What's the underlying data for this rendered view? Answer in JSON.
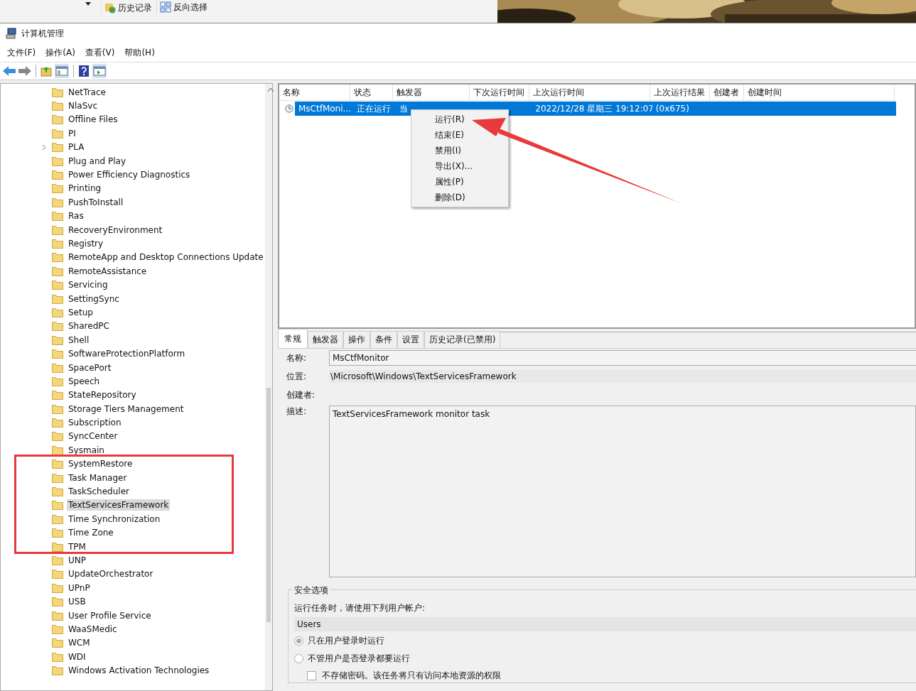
{
  "background_window": {
    "buttons": [
      {
        "label": "历史记录",
        "kind": "history"
      },
      {
        "label": "反向选择",
        "kind": "invert"
      }
    ]
  },
  "window": {
    "title": "计算机管理"
  },
  "menu": [
    "文件(F)",
    "操作(A)",
    "查看(V)",
    "帮助(H)"
  ],
  "tree": {
    "items": [
      {
        "label": "NetTrace",
        "expandable": false,
        "selected": false
      },
      {
        "label": "NlaSvc",
        "expandable": false,
        "selected": false
      },
      {
        "label": "Offline Files",
        "expandable": false,
        "selected": false
      },
      {
        "label": "PI",
        "expandable": false,
        "selected": false
      },
      {
        "label": "PLA",
        "expandable": true,
        "selected": false
      },
      {
        "label": "Plug and Play",
        "expandable": false,
        "selected": false
      },
      {
        "label": "Power Efficiency Diagnostics",
        "expandable": false,
        "selected": false
      },
      {
        "label": "Printing",
        "expandable": false,
        "selected": false
      },
      {
        "label": "PushToInstall",
        "expandable": false,
        "selected": false
      },
      {
        "label": "Ras",
        "expandable": false,
        "selected": false
      },
      {
        "label": "RecoveryEnvironment",
        "expandable": false,
        "selected": false
      },
      {
        "label": "Registry",
        "expandable": false,
        "selected": false
      },
      {
        "label": "RemoteApp and Desktop Connections Update",
        "expandable": false,
        "selected": false
      },
      {
        "label": "RemoteAssistance",
        "expandable": false,
        "selected": false
      },
      {
        "label": "Servicing",
        "expandable": false,
        "selected": false
      },
      {
        "label": "SettingSync",
        "expandable": false,
        "selected": false
      },
      {
        "label": "Setup",
        "expandable": false,
        "selected": false
      },
      {
        "label": "SharedPC",
        "expandable": false,
        "selected": false
      },
      {
        "label": "Shell",
        "expandable": false,
        "selected": false
      },
      {
        "label": "SoftwareProtectionPlatform",
        "expandable": false,
        "selected": false
      },
      {
        "label": "SpacePort",
        "expandable": false,
        "selected": false
      },
      {
        "label": "Speech",
        "expandable": false,
        "selected": false
      },
      {
        "label": "StateRepository",
        "expandable": false,
        "selected": false
      },
      {
        "label": "Storage Tiers Management",
        "expandable": false,
        "selected": false
      },
      {
        "label": "Subscription",
        "expandable": false,
        "selected": false
      },
      {
        "label": "SyncCenter",
        "expandable": false,
        "selected": false
      },
      {
        "label": "Sysmain",
        "expandable": false,
        "selected": false
      },
      {
        "label": "SystemRestore",
        "expandable": false,
        "selected": false
      },
      {
        "label": "Task Manager",
        "expandable": false,
        "selected": false
      },
      {
        "label": "TaskScheduler",
        "expandable": false,
        "selected": false
      },
      {
        "label": "TextServicesFramework",
        "expandable": false,
        "selected": true
      },
      {
        "label": "Time Synchronization",
        "expandable": false,
        "selected": false
      },
      {
        "label": "Time Zone",
        "expandable": false,
        "selected": false
      },
      {
        "label": "TPM",
        "expandable": false,
        "selected": false
      },
      {
        "label": "UNP",
        "expandable": false,
        "selected": false
      },
      {
        "label": "UpdateOrchestrator",
        "expandable": false,
        "selected": false
      },
      {
        "label": "UPnP",
        "expandable": false,
        "selected": false
      },
      {
        "label": "USB",
        "expandable": false,
        "selected": false
      },
      {
        "label": "User Profile Service",
        "expandable": false,
        "selected": false
      },
      {
        "label": "WaaSMedic",
        "expandable": false,
        "selected": false
      },
      {
        "label": "WCM",
        "expandable": false,
        "selected": false
      },
      {
        "label": "WDI",
        "expandable": false,
        "selected": false
      },
      {
        "label": "Windows Activation Technologies",
        "expandable": false,
        "selected": false
      }
    ]
  },
  "task_table": {
    "columns": [
      "名称",
      "状态",
      "触发器",
      "下次运行时间",
      "上次运行时间",
      "上次运行结果",
      "创建者",
      "创建时间"
    ],
    "rows": [
      {
        "selected": true,
        "cells": [
          "MsCtfMoni...",
          "正在运行",
          "当",
          "",
          "2022/12/28 星期三 19:12:07",
          "(0x675)",
          "",
          ""
        ]
      }
    ]
  },
  "context_menu": [
    "运行(R)",
    "结束(E)",
    "禁用(I)",
    "导出(X)...",
    "属性(P)",
    "删除(D)"
  ],
  "detail_tabs": [
    {
      "label": "常规",
      "selected": true
    },
    {
      "label": "触发器",
      "selected": false
    },
    {
      "label": "操作",
      "selected": false
    },
    {
      "label": "条件",
      "selected": false
    },
    {
      "label": "设置",
      "selected": false
    },
    {
      "label": "历史记录(已禁用)",
      "selected": false
    }
  ],
  "general": {
    "name_label": "名称:",
    "name": "MsCtfMonitor",
    "location_label": "位置:",
    "location": "\\Microsoft\\Windows\\TextServicesFramework",
    "author_label": "创建者:",
    "description_label": "描述:",
    "description": "TextServicesFramework monitor task",
    "security": {
      "title": "安全选项",
      "prompt": "运行任务时，请使用下列用户帐户:",
      "account": "Users",
      "options": [
        {
          "label": "只在用户登录时运行",
          "selected": true
        },
        {
          "label": "不管用户是否登录都要运行",
          "selected": false
        }
      ],
      "checkbox": {
        "label": "不存储密码。该任务将只有访问本地资源的权限",
        "checked": false
      }
    }
  }
}
